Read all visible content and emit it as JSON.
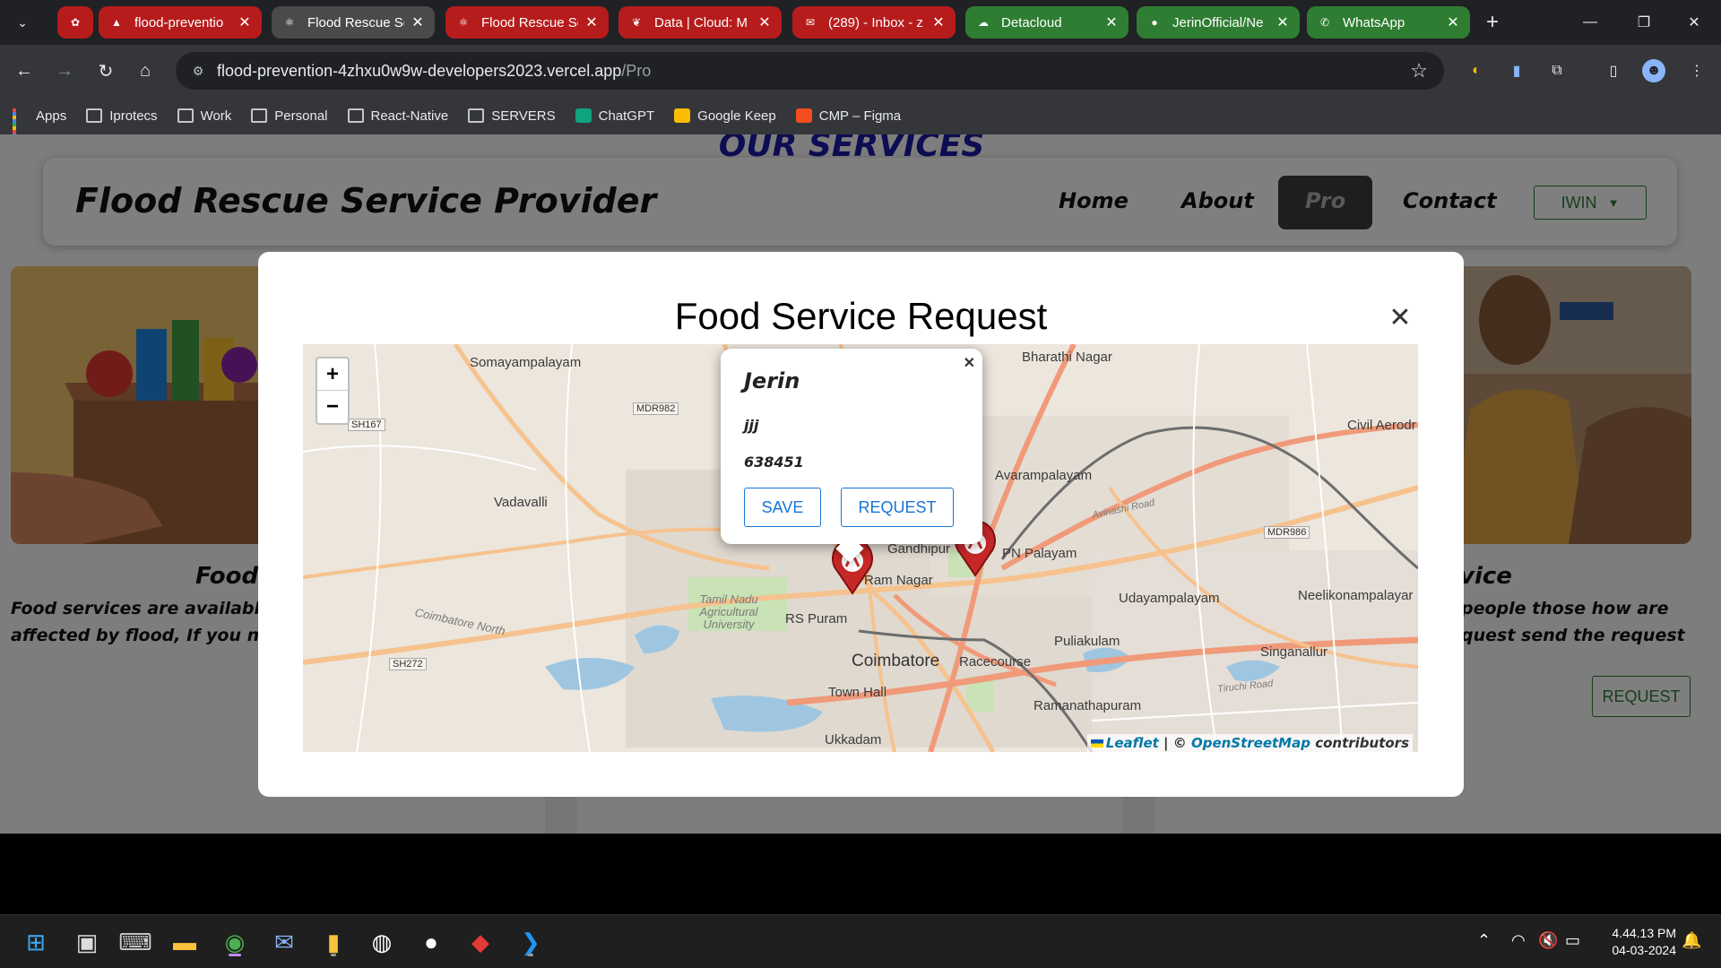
{
  "browser": {
    "tabs": [
      {
        "title": "",
        "favicon": "chatgpt-icon",
        "color": "#b71c1c",
        "active": false
      },
      {
        "title": "flood-preventio",
        "favicon": "vercel-icon",
        "color": "#b71c1c",
        "active": false
      },
      {
        "title": "Flood Rescue Se",
        "favicon": "react-icon",
        "color": "#4a4a4a",
        "active": true
      },
      {
        "title": "Flood Rescue Se",
        "favicon": "react-icon",
        "color": "#b71c1c",
        "active": false
      },
      {
        "title": "Data | Cloud: M",
        "favicon": "mongodb-icon",
        "color": "#b71c1c",
        "active": false
      },
      {
        "title": "(289) - Inbox - z",
        "favicon": "mail-icon",
        "color": "#b71c1c",
        "active": false
      },
      {
        "title": "Detacloud",
        "favicon": "cloud-icon",
        "color": "#2e7d32",
        "active": false
      },
      {
        "title": "JerinOfficial/Ne",
        "favicon": "github-icon",
        "color": "#2e7d32",
        "active": false
      },
      {
        "title": "WhatsApp",
        "favicon": "whatsapp-icon",
        "color": "#2e7d32",
        "active": false
      }
    ],
    "url_main": "flood-prevention-4zhxu0w9w-developers2023.vercel.app",
    "url_path": "/Pro",
    "bookmarks": [
      {
        "label": "Apps",
        "icon": "apps-grid-icon"
      },
      {
        "label": "Iprotecs",
        "icon": "folder-icon"
      },
      {
        "label": "Work",
        "icon": "folder-icon"
      },
      {
        "label": "Personal",
        "icon": "folder-icon"
      },
      {
        "label": "React-Native",
        "icon": "folder-icon"
      },
      {
        "label": "SERVERS",
        "icon": "folder-icon"
      },
      {
        "label": "ChatGPT",
        "icon": "chatgpt-icon"
      },
      {
        "label": "Google Keep",
        "icon": "keep-icon"
      },
      {
        "label": "CMP – Figma",
        "icon": "figma-icon"
      }
    ]
  },
  "page": {
    "services_heading": "OUR SERVICES",
    "brand": "Flood Rescue Service Provider",
    "nav": {
      "home": "Home",
      "about": "About",
      "pro": "Pro",
      "contact": "Contact",
      "user": "IWIN"
    },
    "cards": {
      "left_title": "Food",
      "left_text_1": "Food services are available",
      "left_text_2": "affected by flood, If you ne",
      "right_title": "vice",
      "right_text_1": "people those how are",
      "right_text_2": "quest send the request",
      "right_button": "REQUEST"
    }
  },
  "modal": {
    "title": "Food Service Request",
    "map": {
      "labels": {
        "somayampalayam": "Somayampalayam",
        "bharathi_nagar": "Bharathi Nagar",
        "civil_aerodrome": "Civil Aerodr",
        "avarampalayam": "Avarampalayam",
        "vadavalli": "Vadavalli",
        "gandhipuram": "Gandhipur",
        "pn_palayam": "PN Palayam",
        "ram_nagar": "Ram Nagar",
        "tnau": "Tamil Nadu Agricultural University",
        "rs_puram": "RS Puram",
        "udayampalayam": "Udayampalayam",
        "neelikonampalayam": "Neelikonampalayar",
        "coimbatore": "Coimbatore",
        "racecourse": "Racecourse",
        "puliakulam": "Puliakulam",
        "singanallur": "Singanallur",
        "town_hall": "Town Hall",
        "ramanathapuram": "Ramanathapuram",
        "ukkadam": "Ukkadam",
        "coimbatore_north": "Coimbatore North",
        "mdr982": "MDR982",
        "sh167": "SH167",
        "sh272": "SH272",
        "mdr986": "MDR986",
        "avinashi_road": "Avinashi Road",
        "trichy_road": "Tiruchi Road"
      },
      "zoom_in": "+",
      "zoom_out": "−",
      "attribution_leaflet": "Leaflet",
      "attribution_sep": " | © ",
      "attribution_osm": "OpenStreetMap",
      "attribution_tail": " contributors"
    },
    "popup": {
      "name": "Jerin",
      "line1": "jjj",
      "line2": "638451",
      "save": "SAVE",
      "request": "REQUEST"
    }
  },
  "taskbar": {
    "time": "4.44.13 PM",
    "date": "04-03-2024"
  }
}
